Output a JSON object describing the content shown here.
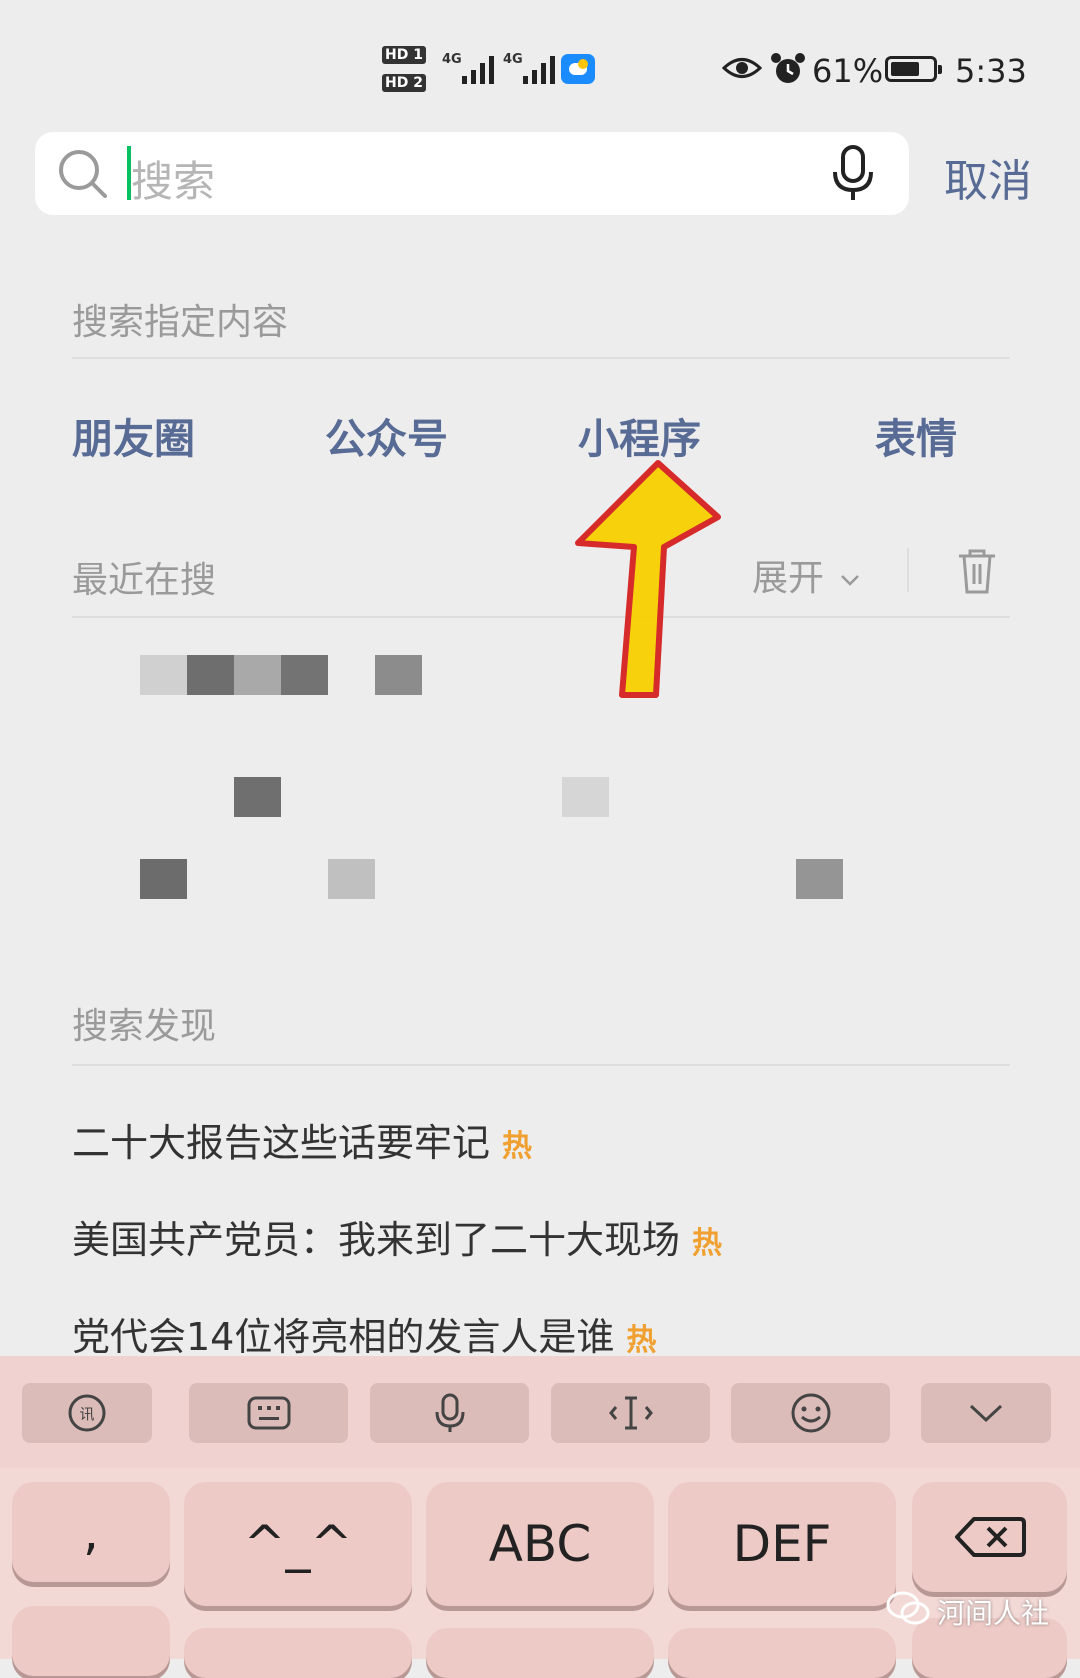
{
  "status_bar": {
    "sim1": "HD 1",
    "sim2": "HD 2",
    "network1": "4G",
    "network2": "4G",
    "battery": "61%",
    "time": "5:33"
  },
  "search": {
    "placeholder": "搜索",
    "cancel": "取消"
  },
  "specified": {
    "title": "搜索指定内容",
    "categories": [
      "朋友圈",
      "公众号",
      "小程序",
      "表情"
    ]
  },
  "recent": {
    "title": "最近在搜",
    "expand": "展开"
  },
  "discover": {
    "title": "搜索发现",
    "items": [
      {
        "text": "二十大报告这些话要牢记",
        "badge": "热"
      },
      {
        "text": "美国共产党员：我来到了二十大现场",
        "badge": "热"
      },
      {
        "text": "党代会14位将亮相的发言人是谁",
        "badge": "热"
      }
    ]
  },
  "keyboard": {
    "keys": [
      ",",
      "^_^",
      "ABC",
      "DEF"
    ],
    "toolbar_icons": [
      "voice-text-icon",
      "keyboard-icon",
      "microphone-icon",
      "cursor-icon",
      "emoji-icon",
      "chevron-down-icon"
    ]
  },
  "watermark": "河间人社",
  "colors": {
    "link_blue": "#576b95",
    "hot_orange": "#f0a030",
    "caret_green": "#07c160",
    "arrow_yellow": "#f7d000",
    "arrow_red": "#d62020",
    "keyboard_bg": "#f3d9d6"
  }
}
